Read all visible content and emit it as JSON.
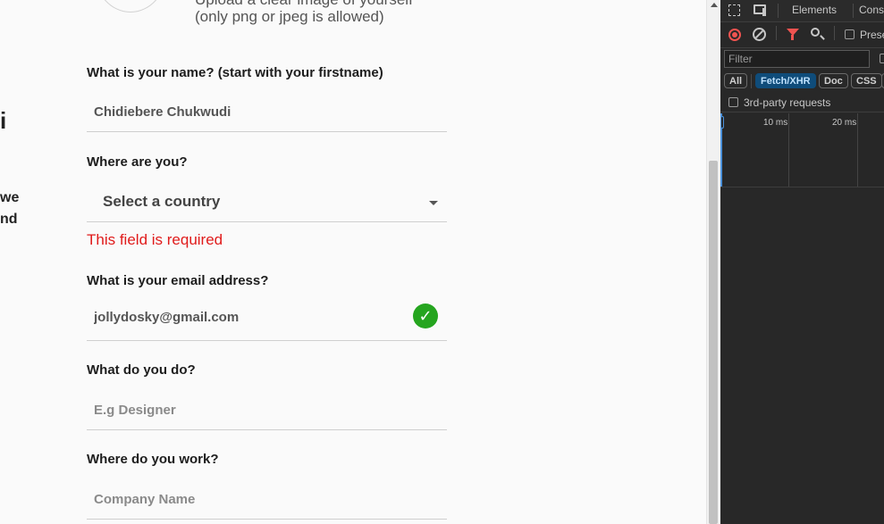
{
  "upload": {
    "hint_line1": "Upload a clear image of yourself",
    "hint_line2": "(only png or jpeg is allowed)"
  },
  "left_fragments": {
    "heading_fragment": "i",
    "text_line1": "we",
    "text_line2": "nd"
  },
  "form": {
    "name": {
      "label": "What is your name? (start with your firstname)",
      "value": "Chidiebere Chukwudi"
    },
    "country": {
      "label": "Where are you?",
      "value": "Select a country",
      "error": "This field is required"
    },
    "email": {
      "label": "What is your email address?",
      "value": "jollydosky@gmail.com",
      "valid_color": "#25a51f"
    },
    "occupation": {
      "label": "What do you do?",
      "placeholder": "E.g Designer",
      "value": ""
    },
    "workplace": {
      "label": "Where do you work?",
      "placeholder": "Company Name",
      "value": ""
    }
  },
  "devtools": {
    "tabs": [
      "Elements",
      "Cons"
    ],
    "preserve_label": "Prese",
    "filter_placeholder": "Filter",
    "type_filters": [
      {
        "label": "All",
        "active": false
      },
      {
        "label": "Fetch/XHR",
        "active": true
      },
      {
        "label": "Doc",
        "active": false
      },
      {
        "label": "CSS",
        "active": false
      }
    ],
    "third_party_label": "3rd-party requests",
    "timeline_ticks": [
      "10 ms",
      "20 ms"
    ]
  },
  "colors": {
    "error": "#e01b1b",
    "valid": "#25a51f",
    "record": "#ef5350",
    "active_filter": "#0f4c7a"
  }
}
